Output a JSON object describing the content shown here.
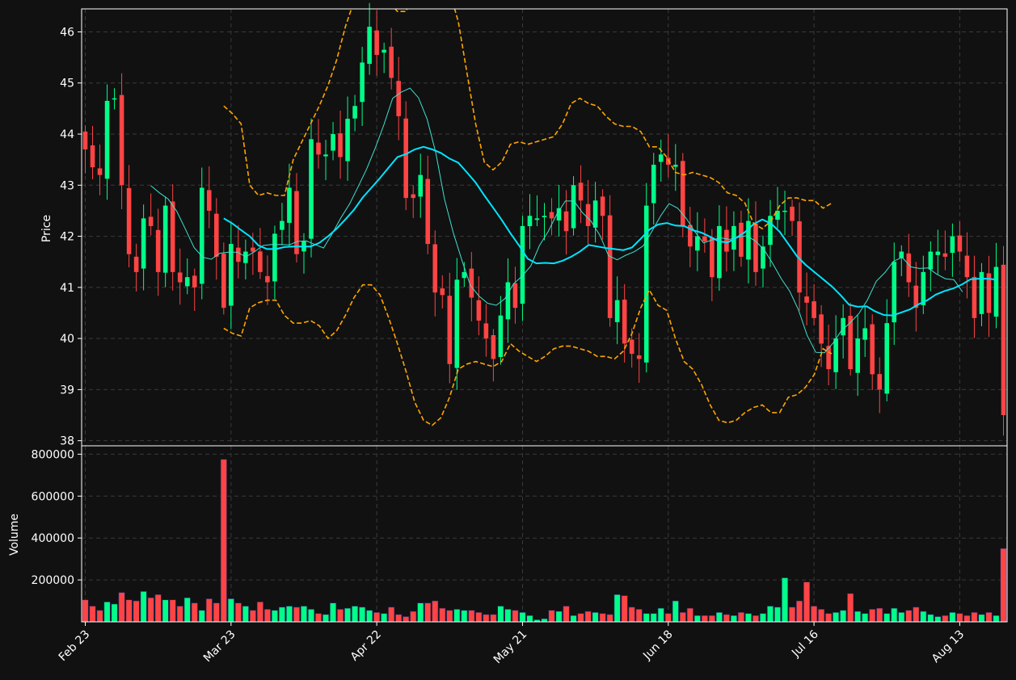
{
  "chart_data": {
    "type": "candlestick",
    "subplots": [
      "price",
      "volume"
    ],
    "ylabel_price": "Price",
    "ylabel_volume": "Volume",
    "price_ylim": [
      37.9,
      46.45
    ],
    "volume_ylim": [
      0,
      840000
    ],
    "price_yticks": [
      38,
      39,
      40,
      41,
      42,
      43,
      44,
      45,
      46
    ],
    "volume_yticks": [
      200000,
      400000,
      600000,
      800000
    ],
    "x_ticks": [
      {
        "index": 0,
        "label": "Feb 23"
      },
      {
        "index": 20,
        "label": "Mar 23"
      },
      {
        "index": 40,
        "label": "Apr 22"
      },
      {
        "index": 60,
        "label": "May 21"
      },
      {
        "index": 80,
        "label": "Jun 18"
      },
      {
        "index": 100,
        "label": "Jul 16"
      },
      {
        "index": 120,
        "label": "Aug 13"
      }
    ],
    "x_range": [
      -0.5,
      126.5
    ],
    "grid": true,
    "colors": {
      "up": "#00ff88",
      "down": "#ff4444",
      "ma_fast": "#40e0d0",
      "ma_slow": "#00e5ff",
      "bands": "#ffa500",
      "background": "#111111",
      "grid": "#3a3a3a",
      "text": "#ffffff"
    },
    "closes": [
      43.7,
      43.35,
      43.2,
      44.65,
      44.7,
      43.0,
      41.65,
      41.3,
      42.35,
      42.2,
      41.3,
      42.6,
      41.3,
      41.1,
      41.2,
      41.0,
      42.95,
      42.5,
      41.6,
      40.6,
      41.85,
      41.5,
      41.7,
      41.7,
      41.3,
      41.1,
      42.05,
      42.3,
      42.95,
      41.65,
      41.9,
      43.9,
      43.6,
      43.6,
      44.0,
      43.55,
      44.3,
      44.55,
      45.4,
      46.1,
      45.55,
      45.65,
      45.1,
      44.35,
      42.75,
      42.75,
      43.2,
      41.85,
      40.9,
      40.85,
      39.5,
      41.15,
      41.3,
      40.8,
      40.35,
      40.0,
      39.6,
      40.45,
      41.1,
      40.6,
      42.2,
      42.4,
      42.35,
      42.4,
      42.35,
      42.55,
      42.1,
      43.0,
      42.7,
      42.2,
      42.7,
      42.4,
      40.4,
      40.75,
      39.9,
      39.7,
      39.6,
      42.6,
      43.4,
      43.6,
      43.4,
      43.4,
      42.2,
      41.8,
      42.0,
      41.9,
      41.2,
      42.2,
      41.7,
      42.2,
      41.6,
      42.3,
      41.3,
      41.8,
      42.4,
      42.5,
      42.5,
      42.3,
      40.9,
      40.7,
      40.4,
      39.9,
      39.4,
      40.0,
      40.4,
      39.4,
      40.0,
      40.2,
      39.3,
      39.0,
      40.3,
      41.5,
      41.7,
      41.1,
      40.6,
      41.3,
      41.7,
      41.7,
      41.6,
      42.0,
      41.7,
      41.2,
      40.4,
      41.3,
      40.5,
      41.4,
      38.5
    ],
    "moving_averages": [
      {
        "start_index": 9,
        "values": [
          42.99,
          42.85,
          42.73,
          42.49,
          42.14,
          41.78,
          41.59,
          41.55,
          41.67,
          41.69,
          41.69,
          41.6,
          41.7,
          41.82,
          41.84,
          41.84,
          41.83,
          41.9,
          41.91,
          41.84,
          41.77,
          42.05,
          42.36,
          42.63,
          42.97,
          43.32,
          43.73,
          44.19,
          44.7,
          44.82,
          44.9,
          44.71,
          44.29,
          43.63,
          42.73,
          42.08,
          41.54,
          41.04,
          40.83,
          40.69,
          40.65,
          40.78,
          41.07,
          41.22,
          41.42,
          41.82,
          42.09,
          42.43,
          42.69,
          42.69,
          42.46,
          42.29,
          42.02,
          41.62,
          41.54,
          41.63,
          41.7,
          41.81,
          42.09,
          42.39,
          42.64,
          42.55,
          42.35,
          42.09,
          41.87,
          41.93,
          41.97,
          41.94,
          41.98,
          42.01,
          41.91,
          41.74,
          41.47,
          41.17,
          40.92,
          40.56,
          40.06,
          39.73,
          39.72,
          39.91,
          40.16,
          40.31,
          40.49,
          40.76,
          41.12,
          41.29,
          41.51,
          41.59,
          41.4,
          41.37,
          41.38,
          41.26,
          41.17,
          41.15,
          40.91
        ],
        "index_step": 1.185
      },
      {
        "start_index": 19,
        "values": [
          42.35,
          42.25,
          42.12,
          42.0,
          41.82,
          41.75,
          41.75,
          41.79,
          41.8,
          41.8,
          41.8,
          41.87,
          42.0,
          42.15,
          42.33,
          42.52,
          42.76,
          42.95,
          43.14,
          43.35,
          43.55,
          43.61,
          43.7,
          43.75,
          43.7,
          43.63,
          43.52,
          43.44,
          43.25,
          43.05,
          42.8,
          42.56,
          42.32,
          42.06,
          41.82,
          41.56,
          41.47,
          41.48,
          41.47,
          41.52,
          41.6,
          41.7,
          41.83,
          41.8,
          41.77,
          41.75,
          41.73,
          41.78,
          41.95,
          42.13,
          42.23,
          42.26,
          42.21,
          42.2,
          42.12,
          42.07,
          41.99,
          41.9,
          41.88,
          41.97,
          42.08,
          42.24,
          42.33,
          42.25,
          42.09,
          41.85,
          41.61,
          41.44,
          41.3,
          41.16,
          41.02,
          40.85,
          40.66,
          40.62,
          40.63,
          40.53,
          40.46,
          40.45,
          40.51,
          40.57,
          40.67,
          40.75,
          40.86,
          40.93,
          40.98,
          41.06,
          41.16,
          41.17,
          41.17,
          41.15
        ],
        "index_step": 1.192
      }
    ],
    "band_upper": {
      "start_index": 19,
      "index_step": 1.192,
      "values": [
        44.55,
        44.4,
        44.2,
        43.0,
        42.8,
        42.85,
        42.8,
        42.8,
        43.5,
        43.85,
        44.2,
        44.55,
        44.95,
        45.45,
        46.1,
        46.6,
        47.0,
        47.1,
        46.95,
        46.6,
        46.4,
        46.4,
        46.9,
        47.1,
        47.2,
        47.1,
        46.8,
        46.2,
        45.2,
        44.2,
        43.45,
        43.3,
        43.45,
        43.8,
        43.85,
        43.8,
        43.85,
        43.9,
        43.95,
        44.2,
        44.6,
        44.7,
        44.6,
        44.55,
        44.35,
        44.2,
        44.15,
        44.15,
        44.05,
        43.75,
        43.75,
        43.55,
        43.25,
        43.2,
        43.25,
        43.2,
        43.15,
        43.05,
        42.85,
        42.8,
        42.65,
        42.25,
        42.15,
        42.3,
        42.6,
        42.75,
        42.75,
        42.7,
        42.7,
        42.55,
        42.65
      ]
    },
    "band_lower": {
      "start_index": 19,
      "index_step": 1.192,
      "values": [
        40.2,
        40.1,
        40.05,
        40.6,
        40.7,
        40.75,
        40.75,
        40.45,
        40.3,
        40.3,
        40.35,
        40.25,
        40.0,
        40.15,
        40.45,
        40.8,
        41.05,
        41.05,
        40.85,
        40.4,
        39.9,
        39.35,
        38.75,
        38.4,
        38.3,
        38.45,
        38.85,
        39.4,
        39.5,
        39.55,
        39.5,
        39.45,
        39.55,
        39.9,
        39.75,
        39.65,
        39.55,
        39.65,
        39.8,
        39.85,
        39.85,
        39.8,
        39.75,
        39.65,
        39.65,
        39.6,
        39.75,
        40.1,
        40.6,
        40.95,
        40.65,
        40.55,
        40.0,
        39.55,
        39.4,
        39.1,
        38.7,
        38.4,
        38.35,
        38.4,
        38.55,
        38.65,
        38.7,
        38.55,
        38.55,
        38.85,
        38.9,
        39.05,
        39.3,
        39.8,
        39.7
      ]
    },
    "volumes": [
      105000,
      75000,
      55000,
      95000,
      85000,
      140000,
      105000,
      100000,
      145000,
      115000,
      130000,
      105000,
      105000,
      75000,
      115000,
      90000,
      55000,
      110000,
      90000,
      775000,
      110000,
      90000,
      75000,
      55000,
      95000,
      60000,
      55000,
      70000,
      75000,
      70000,
      75000,
      60000,
      40000,
      35000,
      90000,
      60000,
      65000,
      75000,
      70000,
      55000,
      45000,
      40000,
      70000,
      35000,
      25000,
      50000,
      90000,
      90000,
      100000,
      65000,
      55000,
      60000,
      55000,
      55000,
      45000,
      35000,
      35000,
      75000,
      60000,
      55000,
      45000,
      30000,
      10000,
      15000,
      55000,
      50000,
      75000,
      30000,
      40000,
      50000,
      45000,
      40000,
      35000,
      130000,
      125000,
      70000,
      60000,
      40000,
      40000,
      65000,
      40000,
      100000,
      45000,
      65000,
      30000,
      30000,
      30000,
      45000,
      35000,
      30000,
      45000,
      40000,
      30000,
      40000,
      75000,
      70000,
      210000,
      70000,
      100000,
      190000,
      75000,
      60000,
      40000,
      45000,
      55000,
      135000,
      50000,
      40000,
      60000,
      65000,
      40000,
      65000,
      45000,
      55000,
      70000,
      50000,
      35000,
      25000,
      30000,
      45000,
      40000,
      30000,
      45000,
      35000,
      45000,
      30000,
      350000
    ]
  }
}
